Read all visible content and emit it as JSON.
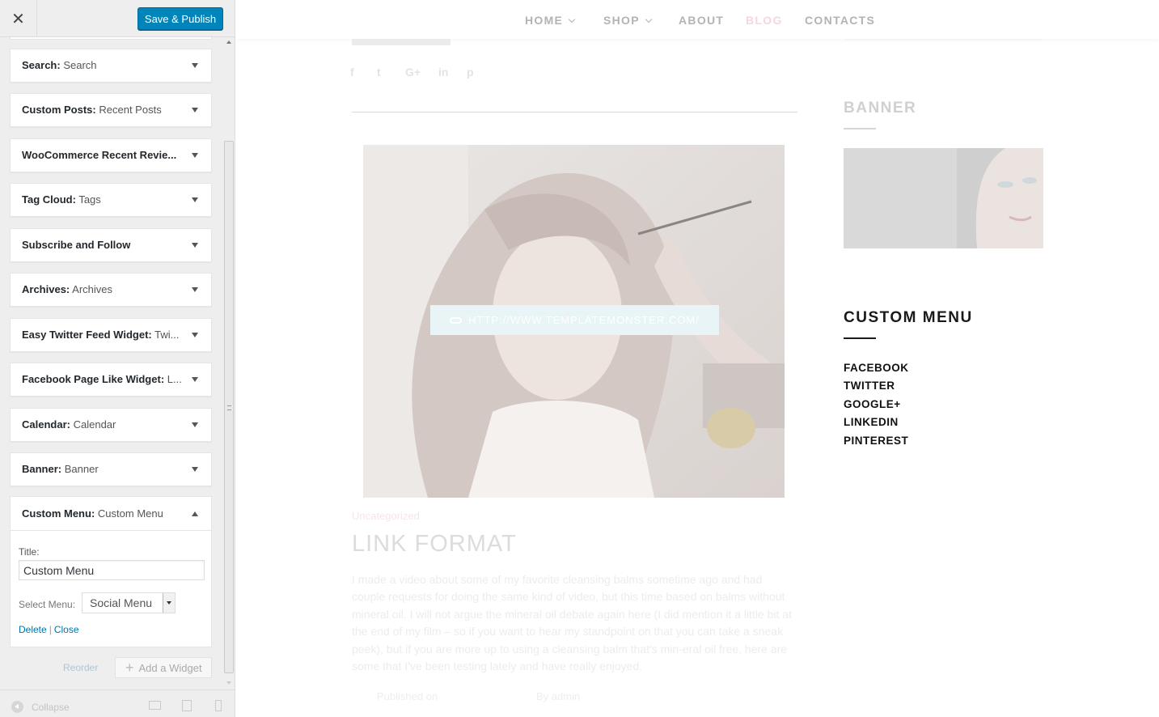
{
  "customizer": {
    "close_label": "✕",
    "publish_label": "Save & Publish",
    "widgets": [
      {
        "type": "Search",
        "title": "Search"
      },
      {
        "type": "Custom Posts",
        "title": "Recent Posts"
      },
      {
        "type": "WooCommerce Recent Revie...",
        "title": ""
      },
      {
        "type": "Tag Cloud",
        "title": "Tags"
      },
      {
        "type": "Subscribe and Follow",
        "title": ""
      },
      {
        "type": "Archives",
        "title": "Archives"
      },
      {
        "type": "Easy Twitter Feed Widget",
        "title": "Twi..."
      },
      {
        "type": "Facebook Page Like Widget",
        "title": "L..."
      },
      {
        "type": "Calendar",
        "title": "Calendar"
      },
      {
        "type": "Banner",
        "title": "Banner"
      }
    ],
    "expanded_widget": {
      "type": "Custom Menu",
      "title": "Custom Menu",
      "title_label": "Title:",
      "title_value": "Custom Menu",
      "select_label": "Select Menu:",
      "select_value": "Social Menu",
      "delete_label": "Delete",
      "separator": "|",
      "close_label": "Close"
    },
    "reorder_label": "Reorder",
    "add_widget_label": "Add a Widget",
    "collapse_label": "Collapse",
    "accent_color": "#0085ba"
  },
  "preview": {
    "nav": [
      {
        "label": "HOME",
        "dropdown": true,
        "active": false
      },
      {
        "label": "SHOP",
        "dropdown": true,
        "active": false
      },
      {
        "label": "ABOUT",
        "dropdown": false,
        "active": false
      },
      {
        "label": "BLOG",
        "dropdown": false,
        "active": true
      },
      {
        "label": "CONTACTS",
        "dropdown": false,
        "active": false
      }
    ],
    "post": {
      "link": "HTTP://WWW.TEMPLATEMONSTER.COM/",
      "category": "Uncategorized",
      "title": "LINK FORMAT",
      "excerpt": "I made a video about some of my favorite cleansing balms sometime ago and had couple requests for doing the same kind of video, but this time based on balms without mineral oil. I will not argue the mineral oil debate again here (I did mention it a little bit at the end of my film – so if you want to hear my standpoint on that you can take a sneak peek), but if you are more up to using a cleansing balm that's min-eral oil free, here are some that I've been testing lately and have really enjoyed.",
      "meta_published": "Published on",
      "meta_author": "By admin"
    },
    "sidebar": {
      "banner_title": "BANNER",
      "menu_title": "CUSTOM MENU",
      "menu_items": [
        "FACEBOOK",
        "TWITTER",
        "GOOGLE+",
        "LINKEDIN",
        "PINTEREST"
      ]
    }
  }
}
